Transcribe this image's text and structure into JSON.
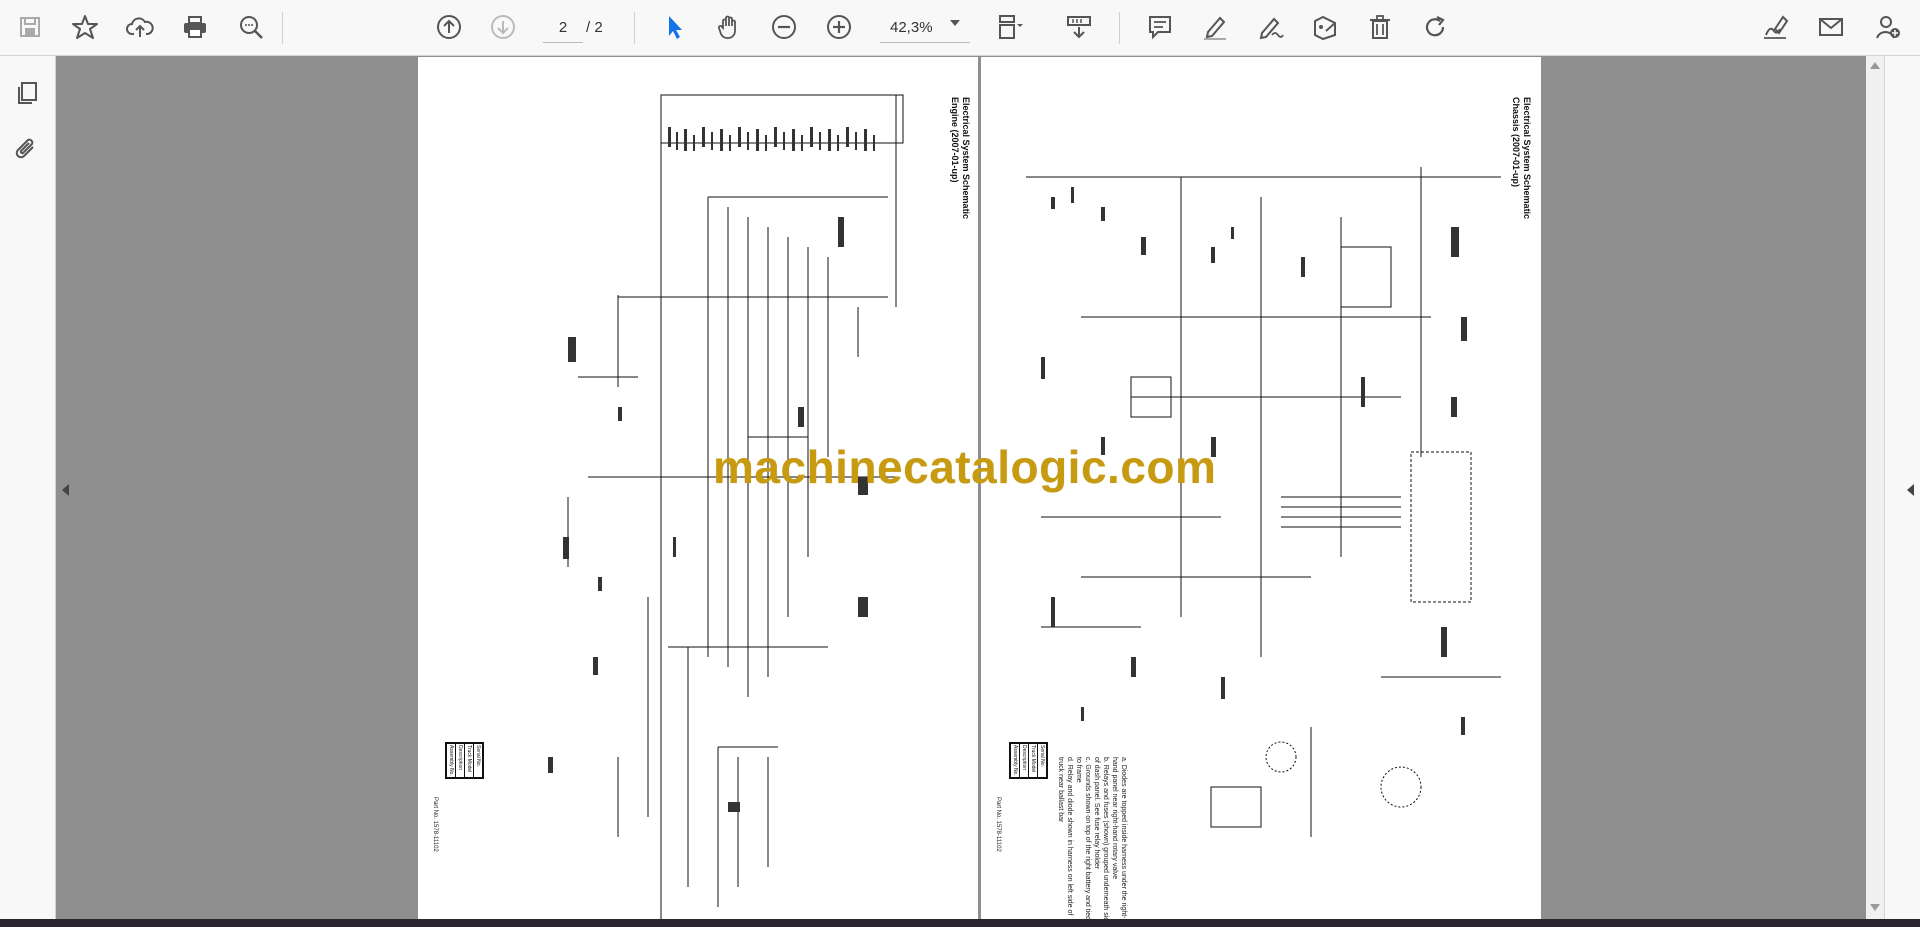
{
  "toolbar": {
    "icons": [
      "save-icon",
      "star-icon",
      "cloud-upload-icon",
      "print-icon",
      "zoom-search-icon",
      "page-up-icon",
      "page-down-icon",
      "select-cursor-icon",
      "hand-icon",
      "zoom-out-icon",
      "zoom-in-icon",
      "page-fit-icon",
      "scroll-mode-icon",
      "comment-icon",
      "highlight-pen-icon",
      "draw-icon",
      "stamp-icon",
      "delete-icon",
      "rotate-icon",
      "sign-icon",
      "email-icon",
      "add-account-icon"
    ],
    "current_page": "2",
    "total_pages": "/ 2",
    "zoom": "42,3%"
  },
  "left_panel": {
    "icons": [
      "pages-icon",
      "attachment-icon"
    ]
  },
  "document": {
    "watermark": "machinecatalogic.com",
    "left_page": {
      "title_line1": "Electrical System Schematic",
      "title_line2": "Engine (2007-01-up)",
      "table_headers": [
        "Assembly No.",
        "Description",
        "Truck Model",
        "Serial No."
      ],
      "part_no": "Part No. 1578-11102"
    },
    "right_page": {
      "title_line1": "Electrical System Schematic",
      "title_line2": "Chassis (2007-01-up)",
      "notes": [
        "a. Diodes are topped inside harness under the right-hand panel near right-hand rotary valve",
        "b. Relays and fuses (shown) grouped underneath side of dash panel. See fuse relay holder",
        "c. Grounds shown on top of the right battery and tied to frame",
        "d. Relay and diode shown in harness on left side of truck near ballast bar"
      ],
      "table_headers": [
        "Assembly No.",
        "Description",
        "Truck Model",
        "Serial No."
      ],
      "part_no": "Part No. 1578-11102"
    }
  },
  "colors": {
    "watermark": "#c89a10",
    "toolbar_bg": "#f8f8f8",
    "viewer_bg": "#8f8f8f",
    "accent": "#1473e6"
  }
}
